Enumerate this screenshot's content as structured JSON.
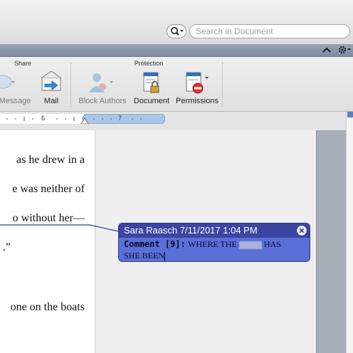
{
  "search": {
    "placeholder": "Search in Document"
  },
  "ribbon": {
    "groups": [
      {
        "title": "Share"
      },
      {
        "title": "Protection"
      }
    ],
    "buttons": {
      "message": "Message",
      "mail": "Mail",
      "block_authors": "Block Authors",
      "document": "Document",
      "permissions": "Permissions"
    }
  },
  "ruler": {
    "marks": [
      "6",
      "7"
    ]
  },
  "document": {
    "lines": [
      "as he drew in a",
      "e was neither of",
      "o without her—",
      ".”",
      "one on the boats"
    ]
  },
  "comment": {
    "author": "Sara Raasch",
    "date": "7/11/2017",
    "time": "1:04 PM",
    "title": "Sara Raasch 7/11/2017 1:04 PM",
    "label": "Comment [9]:",
    "text_before": "WHERE THE",
    "text_after": "HAS",
    "text_line2": "SHE BEEN"
  },
  "colors": {
    "balloon": "#5b6fd8",
    "balloon_header": "#3c45a0",
    "ribbon_tabstrip": "#8896aa"
  }
}
